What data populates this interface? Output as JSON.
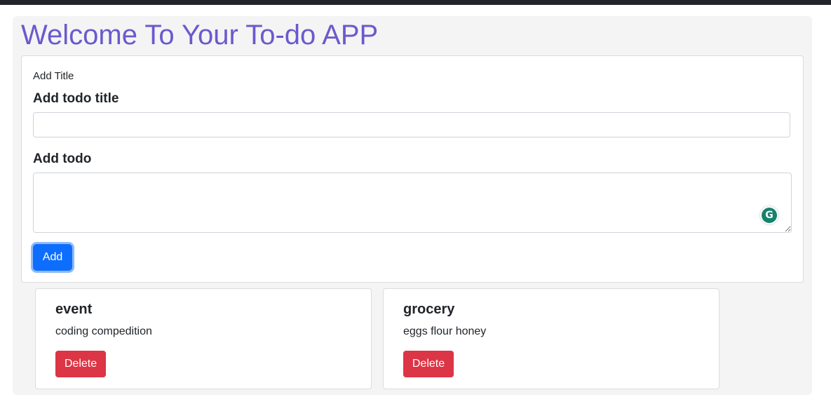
{
  "app": {
    "title": "Welcome To Your To-do APP"
  },
  "form": {
    "heading": "Add Title",
    "title_label": "Add todo title",
    "title_value": "",
    "todo_label": "Add todo",
    "todo_value": "",
    "add_button": "Add",
    "grammarly_glyph": "G"
  },
  "todos": [
    {
      "title": "event",
      "description": "coding compedition",
      "delete_label": "Delete"
    },
    {
      "title": "grocery",
      "description": "eggs flour honey",
      "delete_label": "Delete"
    }
  ],
  "colors": {
    "title": "#6a5acd",
    "primary": "#0d6efd",
    "danger": "#dc3545",
    "grammarly": "#15826b"
  }
}
